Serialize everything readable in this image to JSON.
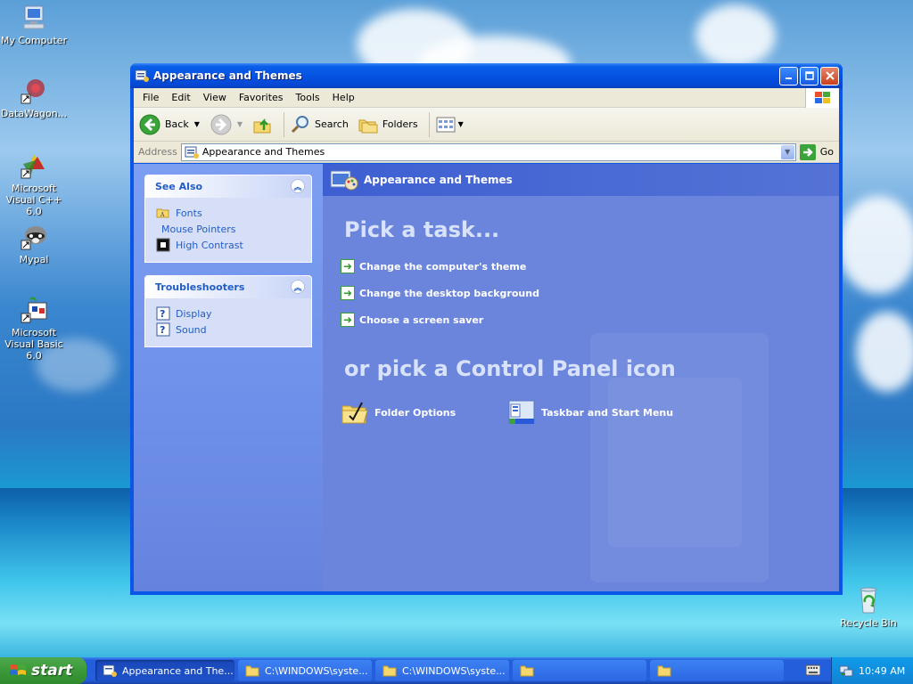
{
  "desktop": {
    "icons": [
      {
        "label": "My Computer"
      },
      {
        "label": "DataWagon..."
      },
      {
        "label": "Microsoft Visual C++ 6.0"
      },
      {
        "label": "Mypal"
      },
      {
        "label": "Microsoft Visual Basic 6.0"
      },
      {
        "label": "Recycle Bin"
      }
    ]
  },
  "window": {
    "title": "Appearance and Themes",
    "menu": [
      "File",
      "Edit",
      "View",
      "Favorites",
      "Tools",
      "Help"
    ],
    "toolbar": {
      "back": "Back",
      "search": "Search",
      "folders": "Folders"
    },
    "address": {
      "label": "Address",
      "value": "Appearance and Themes",
      "go": "Go"
    },
    "left_pane": {
      "see_also": {
        "title": "See Also",
        "items": [
          "Fonts",
          "Mouse Pointers",
          "High Contrast"
        ]
      },
      "troubleshooters": {
        "title": "Troubleshooters",
        "items": [
          "Display",
          "Sound"
        ]
      }
    },
    "right_pane": {
      "header": "Appearance and Themes",
      "pick_task": "Pick a task...",
      "tasks": [
        "Change the computer's theme",
        "Change the desktop background",
        "Choose a screen saver"
      ],
      "pick_icon": "or pick a Control Panel icon",
      "icons": [
        "Folder Options",
        "Taskbar and Start Menu"
      ]
    }
  },
  "taskbar": {
    "start": "start",
    "items": [
      "Appearance and The...",
      "C:\\WINDOWS\\syste...",
      "C:\\WINDOWS\\syste...",
      "",
      ""
    ],
    "clock": "10:49 AM"
  },
  "colors": {
    "title_blue": "#0553e3",
    "link_blue": "#215dc6",
    "pane_blue": "#6b85dc",
    "start_green": "#3c9a39"
  }
}
